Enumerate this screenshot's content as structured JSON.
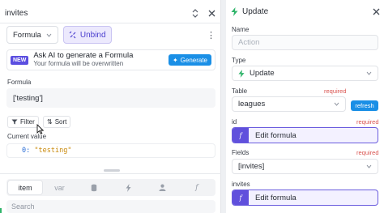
{
  "left": {
    "title": "invites",
    "mode_select": "Formula",
    "unbind_label": "Unbind",
    "ai": {
      "badge": "NEW",
      "title": "Ask AI to generate a Formula",
      "subtitle": "Your formula will be overwritten",
      "button": "Generate"
    },
    "formula_label": "Formula",
    "formula_value": "['testing']",
    "filter_label": "Filter",
    "sort_label": "Sort",
    "current_value_label": "Current value",
    "current_value_key": "0:",
    "current_value_val": "\"testing\"",
    "tabs": [
      "item",
      "var",
      "",
      "",
      "",
      ""
    ],
    "search_placeholder": "Search"
  },
  "right": {
    "title": "Update",
    "name": {
      "label": "Name",
      "placeholder": "Action"
    },
    "type": {
      "label": "Type",
      "value": "Update"
    },
    "table": {
      "label": "Table",
      "required": "required",
      "value": "leagues",
      "refresh": "refresh"
    },
    "id": {
      "label": "id",
      "required": "required",
      "formula": "Edit formula"
    },
    "fields": {
      "label": "Fields",
      "required": "required",
      "value": "[invites]"
    },
    "invites": {
      "label": "invites",
      "formula": "Edit formula"
    },
    "fx_glyph": "f"
  },
  "colors": {
    "accent_purple": "#5b4ee0",
    "accent_blue": "#1a8fe6",
    "required_red": "#d9534f",
    "bolt_green": "#2fb46a"
  }
}
